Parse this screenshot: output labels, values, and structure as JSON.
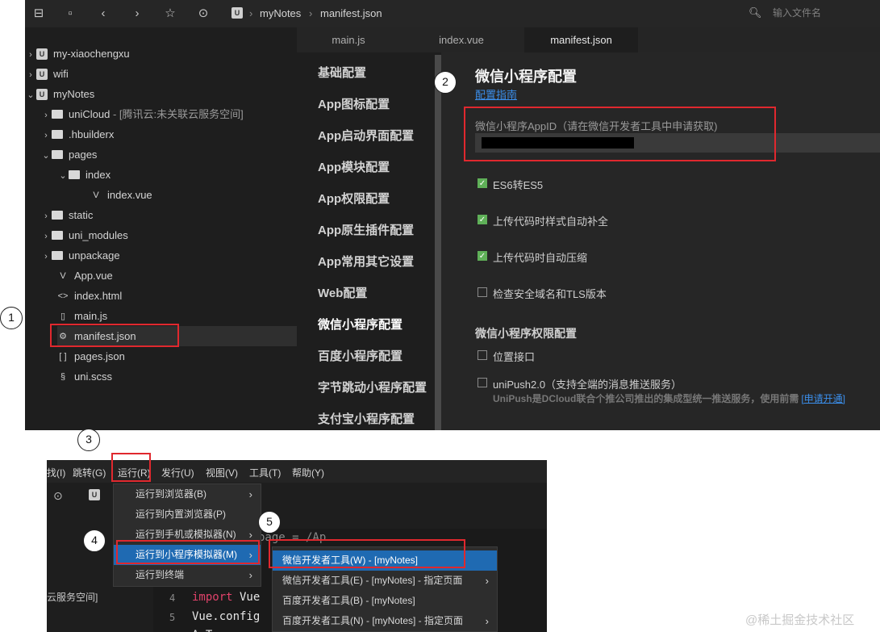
{
  "toolbar": {
    "breadcrumb_project": "myNotes",
    "breadcrumb_file": "manifest.json",
    "search_placeholder": "输入文件名"
  },
  "tree": {
    "items": [
      {
        "label": "my-xiaochengxu"
      },
      {
        "label": "wifi"
      },
      {
        "label": "myNotes"
      },
      {
        "label": "uniCloud",
        "note": "- [腾讯云:未关联云服务空间]"
      },
      {
        "label": ".hbuilderx"
      },
      {
        "label": "pages"
      },
      {
        "label": "index"
      },
      {
        "label": "index.vue"
      },
      {
        "label": "static"
      },
      {
        "label": "uni_modules"
      },
      {
        "label": "unpackage"
      },
      {
        "label": "App.vue"
      },
      {
        "label": "index.html"
      },
      {
        "label": "main.js"
      },
      {
        "label": "manifest.json"
      },
      {
        "label": "pages.json"
      },
      {
        "label": "uni.scss"
      }
    ]
  },
  "tabs": [
    "main.js",
    "index.vue",
    "manifest.json"
  ],
  "config_menu": [
    "基础配置",
    "App图标配置",
    "App启动界面配置",
    "App模块配置",
    "App权限配置",
    "App原生插件配置",
    "App常用其它设置",
    "Web配置",
    "微信小程序配置",
    "百度小程序配置",
    "字节跳动小程序配置",
    "支付宝小程序配置"
  ],
  "settings": {
    "title": "微信小程序配置",
    "guide_link": "配置指南",
    "appid_label": "微信小程序AppID（请在微信开发者工具中申请获取)",
    "options": [
      {
        "label": "ES6转ES5",
        "checked": true
      },
      {
        "label": "上传代码时样式自动补全",
        "checked": true
      },
      {
        "label": "上传代码时自动压缩",
        "checked": true
      },
      {
        "label": "检查安全域名和TLS版本",
        "checked": false
      }
    ],
    "permission_title": "微信小程序权限配置",
    "permissions": [
      {
        "label": "位置接口",
        "checked": false
      },
      {
        "label": "uniPush2.0（支持全端的消息推送服务）",
        "checked": false
      }
    ],
    "unipush_desc": "UniPush是DCloud联合个推公司推出的集成型统一推送服务，使用前需",
    "unipush_link": "[申请开通]"
  },
  "menubar": [
    "找(I)",
    "跳转(G)",
    "运行(R)",
    "发行(U)",
    "视图(V)",
    "工具(T)",
    "帮助(Y)"
  ],
  "run_menu": [
    {
      "label": "运行到浏览器(B)",
      "has_sub": true
    },
    {
      "label": "运行到内置浏览器(P)",
      "has_sub": false
    },
    {
      "label": "运行到手机或模拟器(N)",
      "has_sub": true
    },
    {
      "label": "运行到小程序模拟器(M)",
      "has_sub": true
    },
    {
      "label": "运行到终端",
      "has_sub": true
    }
  ],
  "mp_submenu": [
    {
      "label": "微信开发者工具(W) - [myNotes]",
      "has_sub": false
    },
    {
      "label": "微信开发者工具(E) - [myNotes] - 指定页面",
      "has_sub": true
    },
    {
      "label": "百度开发者工具(B) - [myNotes]",
      "has_sub": false
    },
    {
      "label": "百度开发者工具(N) - [myNotes] - 指定页面",
      "has_sub": true
    }
  ],
  "bottom_side_text": "云服务空间]",
  "code": {
    "line4_num": "4",
    "line4_kw": "import",
    "line4_rest": " Vue",
    "line5_num": "5",
    "line5_text": "Vue.config",
    "partial_top": "page = /Ap",
    "partial_bottom": "A    T"
  },
  "step_badges": [
    "1",
    "2",
    "3",
    "4",
    "5"
  ],
  "watermark": "@稀土掘金技术社区",
  "colors": {
    "highlight": "#e0282e",
    "accent_blue": "#1f6ab2",
    "link_blue": "#3b8eea",
    "check_green": "#5fb058"
  }
}
